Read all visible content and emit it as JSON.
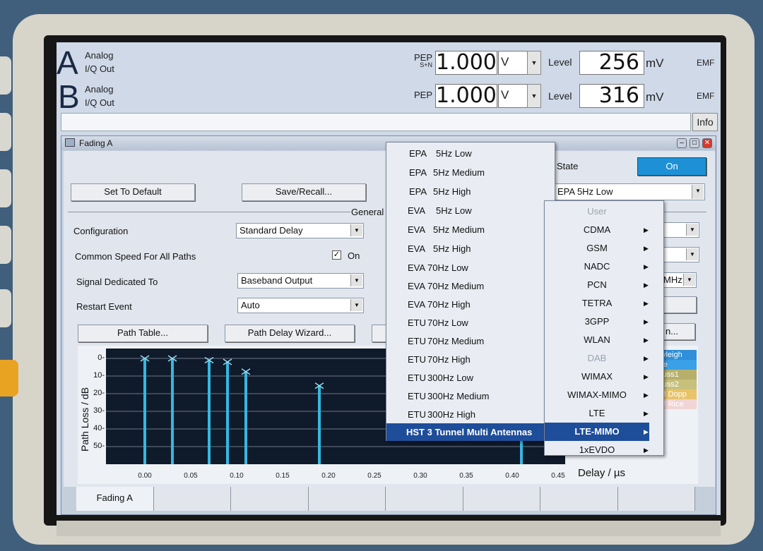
{
  "header": {
    "a": {
      "letter": "A",
      "line1": "Analog",
      "line2": "I/Q Out",
      "pep": "PEP",
      "pep_sub": "S+N",
      "pep_value": "1.000",
      "pep_unit": "V",
      "level_label": "Level",
      "level_value": "256",
      "level_unit": "mV",
      "emf": "EMF"
    },
    "b": {
      "letter": "B",
      "line1": "Analog",
      "line2": "I/Q Out",
      "pep": "PEP",
      "pep_value": "1.000",
      "pep_unit": "V",
      "level_label": "Level",
      "level_value": "316",
      "level_unit": "mV",
      "emf": "EMF"
    },
    "info_button": "Info"
  },
  "window": {
    "title": "Fading A",
    "state_label": "State",
    "state_value": "On",
    "set_to_default": "Set To Default",
    "save_recall": "Save/Recall...",
    "general_label": "General",
    "fields": [
      {
        "label": "Configuration",
        "value": "Standard Delay"
      },
      {
        "label": "Common Speed For All Paths",
        "checkbox": "On"
      },
      {
        "label": "Signal Dedicated To",
        "value": "Baseband Output"
      },
      {
        "label": "Restart Event",
        "value": "Auto"
      }
    ],
    "path_table": "Path Table...",
    "path_delay_wizard": "Path Delay Wizard...",
    "standard_value": "EPA  5Hz Low",
    "mhz_unit": "MHz",
    "partial_button": "n..."
  },
  "chart_data": {
    "type": "bar",
    "ylabel": "Path Loss / dB",
    "xlabel": "Delay  / µs",
    "y_ticks": [
      "0-",
      "10-",
      "20-",
      "30-",
      "40-",
      "50-"
    ],
    "x_ticks": [
      "0.00",
      "0.05",
      "0.10",
      "0.15",
      "0.20",
      "0.25",
      "0.30",
      "0.35",
      "0.40",
      "0.45"
    ],
    "xlim": [
      0,
      0.45
    ],
    "ylim": [
      0,
      55
    ],
    "paths": [
      {
        "delay": 0.0,
        "loss": 0
      },
      {
        "delay": 0.03,
        "loss": 0
      },
      {
        "delay": 0.07,
        "loss": 1
      },
      {
        "delay": 0.09,
        "loss": 2
      },
      {
        "delay": 0.11,
        "loss": 7.5
      },
      {
        "delay": 0.19,
        "loss": 15.5
      },
      {
        "delay": 0.41,
        "loss": 45
      }
    ],
    "legend": [
      {
        "name": "Rayleigh",
        "color": "#2f8fd8"
      },
      {
        "name": "Rice",
        "color": "#3aa0e8"
      },
      {
        "name": "Gauss1",
        "color": "#b8b06a"
      },
      {
        "name": "Gauss2",
        "color": "#c7c07a"
      },
      {
        "name": "WM Dopp",
        "color": "#e8c36a"
      },
      {
        "name": "WM Rice",
        "color": "#f1d5d5"
      }
    ]
  },
  "standards_menu": [
    {
      "group": "EPA",
      "name": "5Hz Low"
    },
    {
      "group": "EPA",
      "name": "5Hz Medium"
    },
    {
      "group": "EPA",
      "name": "5Hz High"
    },
    {
      "group": "EVA",
      "name": "5Hz Low"
    },
    {
      "group": "EVA",
      "name": "5Hz Medium"
    },
    {
      "group": "EVA",
      "name": "5Hz High"
    },
    {
      "group": "EVA",
      "name": "70Hz Low"
    },
    {
      "group": "EVA",
      "name": "70Hz Medium"
    },
    {
      "group": "EVA",
      "name": "70Hz High"
    },
    {
      "group": "ETU",
      "name": "70Hz Low"
    },
    {
      "group": "ETU",
      "name": "70Hz Medium"
    },
    {
      "group": "ETU",
      "name": "70Hz High"
    },
    {
      "group": "ETU",
      "name": "300Hz Low"
    },
    {
      "group": "ETU",
      "name": "300Hz Medium"
    },
    {
      "group": "ETU",
      "name": "300Hz High"
    },
    {
      "group": "HST 3 Tunnel Multi Antennas",
      "name": ""
    }
  ],
  "standards_menu_selected": "HST 3 Tunnel Multi Antennas",
  "category_menu": [
    "User",
    "CDMA",
    "GSM",
    "NADC",
    "PCN",
    "TETRA",
    "3GPP",
    "WLAN",
    "DAB",
    "WIMAX",
    "WIMAX-MIMO",
    "LTE",
    "LTE-MIMO",
    "1xEVDO"
  ],
  "category_menu_selected": "LTE-MIMO",
  "tabs": [
    "Fading A",
    "",
    "",
    "",
    "",
    "",
    "",
    ""
  ]
}
